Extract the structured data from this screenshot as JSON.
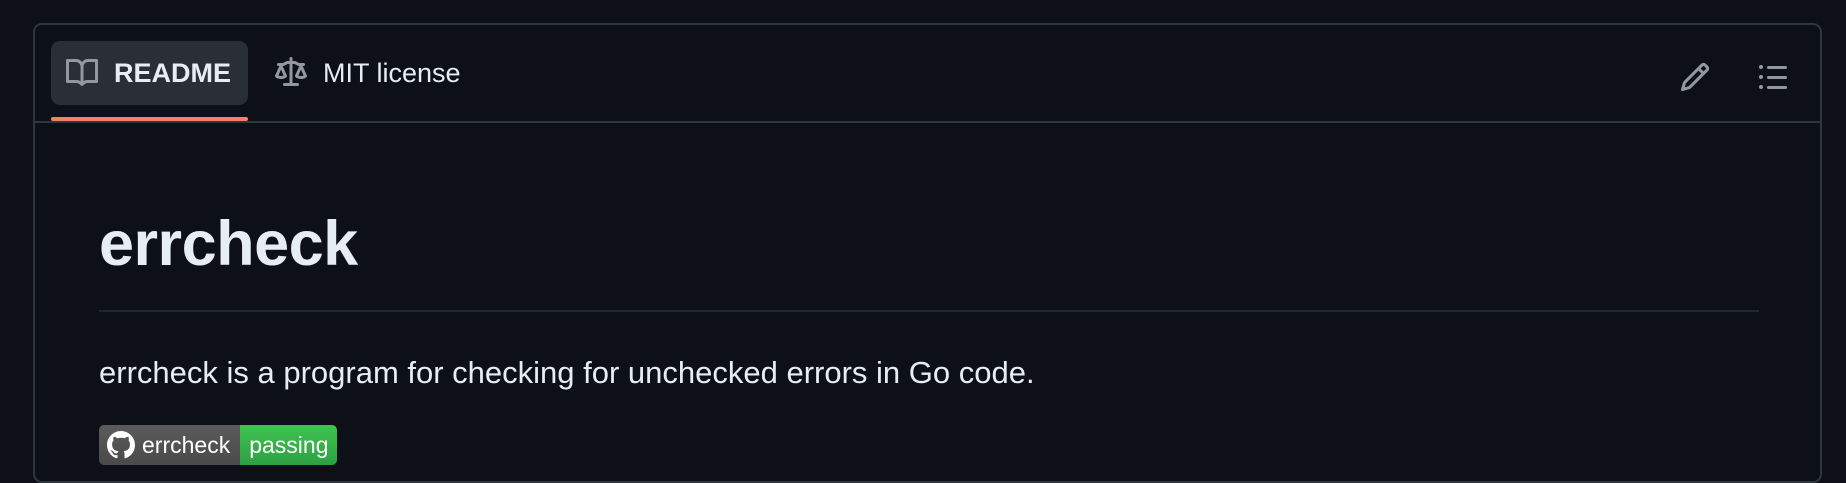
{
  "tabs": [
    {
      "label": "README",
      "icon": "book-icon",
      "active": true
    },
    {
      "label": "MIT license",
      "icon": "law-scale-icon",
      "active": false
    }
  ],
  "toolbar": {
    "edit_icon": "pencil-icon",
    "toc_icon": "list-unordered-icon"
  },
  "readme": {
    "title": "errcheck",
    "description": "errcheck is a program for checking for unchecked errors in Go code.",
    "badge": {
      "label": "errcheck",
      "status": "passing",
      "icon": "github-icon"
    }
  },
  "colors": {
    "background": "#0d1117",
    "border": "#30363d",
    "active_tab_bg": "#2a2f36",
    "active_underline": "#f78166",
    "badge_label_bg": "#555555",
    "badge_status_bg": "#2ea043"
  }
}
